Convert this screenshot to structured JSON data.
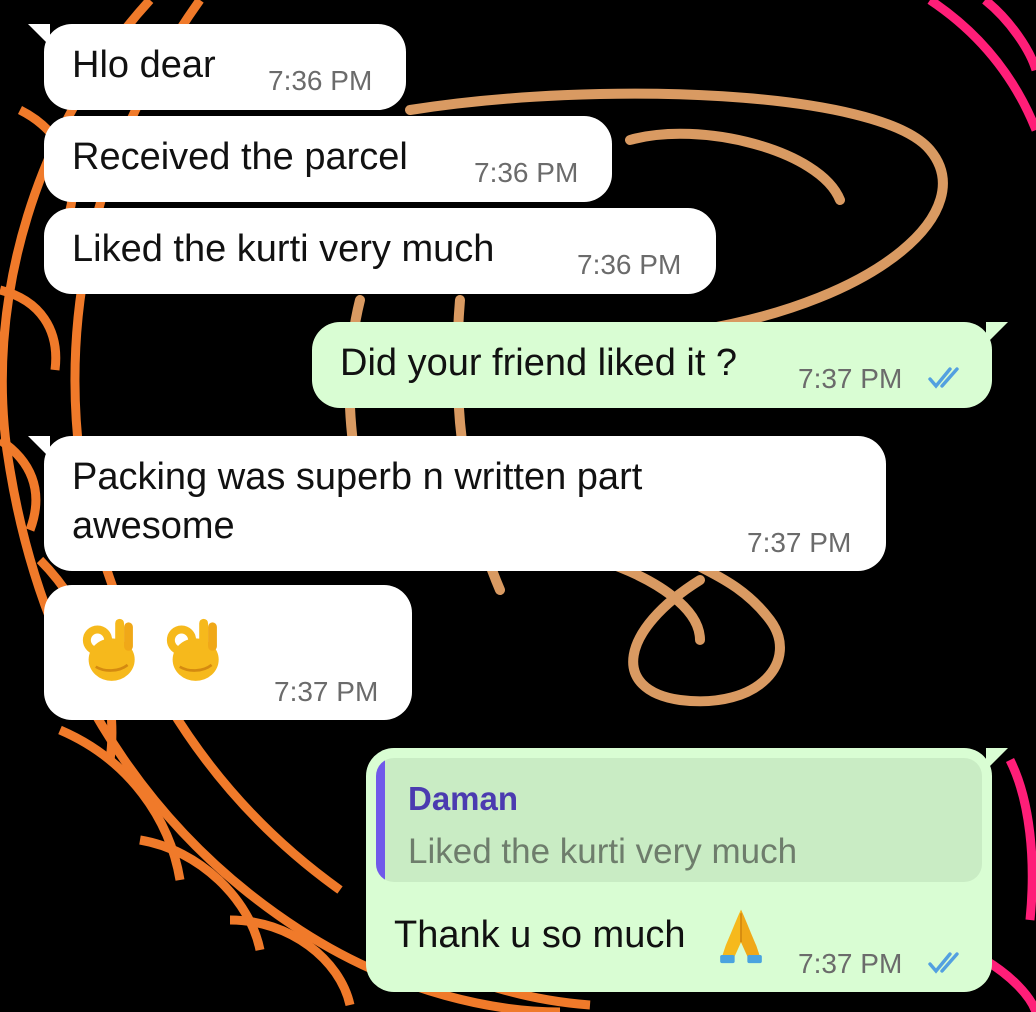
{
  "messages": [
    {
      "direction": "incoming",
      "text": "Hlo dear",
      "time": "7:36 PM"
    },
    {
      "direction": "incoming",
      "text": "Received the parcel",
      "time": "7:36 PM"
    },
    {
      "direction": "incoming",
      "text": "Liked the kurti very much",
      "time": "7:36 PM"
    },
    {
      "direction": "outgoing",
      "text": "Did your friend liked it ?",
      "time": "7:37 PM",
      "status": "read"
    },
    {
      "direction": "incoming",
      "text_line1": "Packing was superb n written part",
      "text_line2": "awesome",
      "time": "7:37 PM"
    },
    {
      "direction": "incoming",
      "emoji": [
        "ok-hand-emoji",
        "ok-hand-emoji"
      ],
      "time": "7:37 PM"
    },
    {
      "direction": "outgoing",
      "reply_to": {
        "author": "Daman",
        "text": "Liked the kurti very much"
      },
      "text": "Thank u so much",
      "emoji": "folded-hands-emoji",
      "time": "7:37 PM",
      "status": "read"
    }
  ],
  "colors": {
    "incoming_bubble": "#ffffff",
    "outgoing_bubble": "#d9fdd3",
    "read_ticks": "#53a0e0",
    "quote_bar": "#7059ea",
    "quote_author": "#4b3bb0",
    "wallpaper_background": "#000000",
    "wallpaper_mandala": "#f07a2a",
    "wallpaper_script": "#d99a62",
    "wallpaper_accent": "#ff1e78"
  }
}
